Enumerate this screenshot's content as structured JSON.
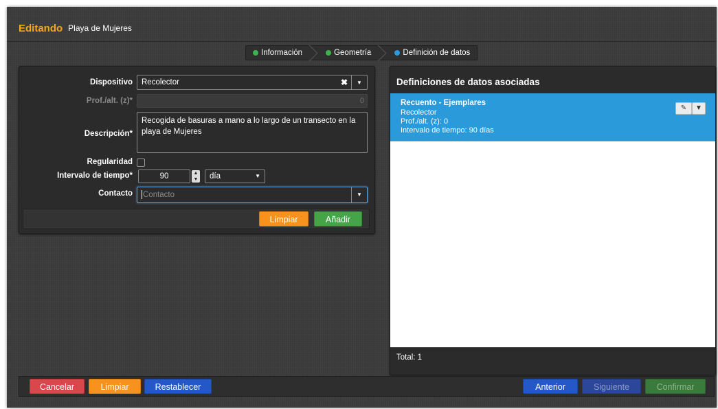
{
  "header": {
    "mode": "Editando",
    "name": "Playa de Mujeres"
  },
  "steps": [
    {
      "label": "Información",
      "color": "#3cb44b"
    },
    {
      "label": "Geometría",
      "color": "#3cb44b"
    },
    {
      "label": "Definición de datos",
      "color": "#2b9adb"
    }
  ],
  "form": {
    "device_label": "Dispositivo",
    "device_value": "Recolector",
    "depth_label": "Prof./alt. (z)*",
    "depth_value": "0",
    "description_label": "Descripción*",
    "description_value": "Recogida de basuras a mano a lo largo de un transecto en la playa de Mujeres",
    "regularity_label": "Regularidad",
    "regularity_checked": false,
    "interval_label": "Intervalo de tiempo*",
    "interval_value": "90",
    "interval_unit": "día",
    "contact_label": "Contacto",
    "contact_placeholder": "Contacto",
    "clear_label": "Limpiar",
    "add_label": "Añadir"
  },
  "definitions": {
    "title": "Definiciones de datos asociadas",
    "records": [
      {
        "title": "Recuento - Ejemplares",
        "device": "Recolector",
        "depth": "Prof./alt. (z): 0",
        "interval": "Intervalo de tiempo: 90 días"
      }
    ],
    "total": "Total: 1"
  },
  "footer": {
    "cancel": "Cancelar",
    "clear": "Limpiar",
    "reset": "Restablecer",
    "previous": "Anterior",
    "next": "Siguiente",
    "confirm": "Confirmar"
  },
  "icons": {
    "edit": "edit-icon",
    "caret": "caret-down-icon",
    "clear": "clear-x-icon"
  },
  "colors": {
    "accent": "#f5a623",
    "selected_row": "#2b9adb",
    "orange": "#f7921e",
    "green": "#45a447",
    "red": "#d9474d",
    "blue": "#2458c8"
  }
}
